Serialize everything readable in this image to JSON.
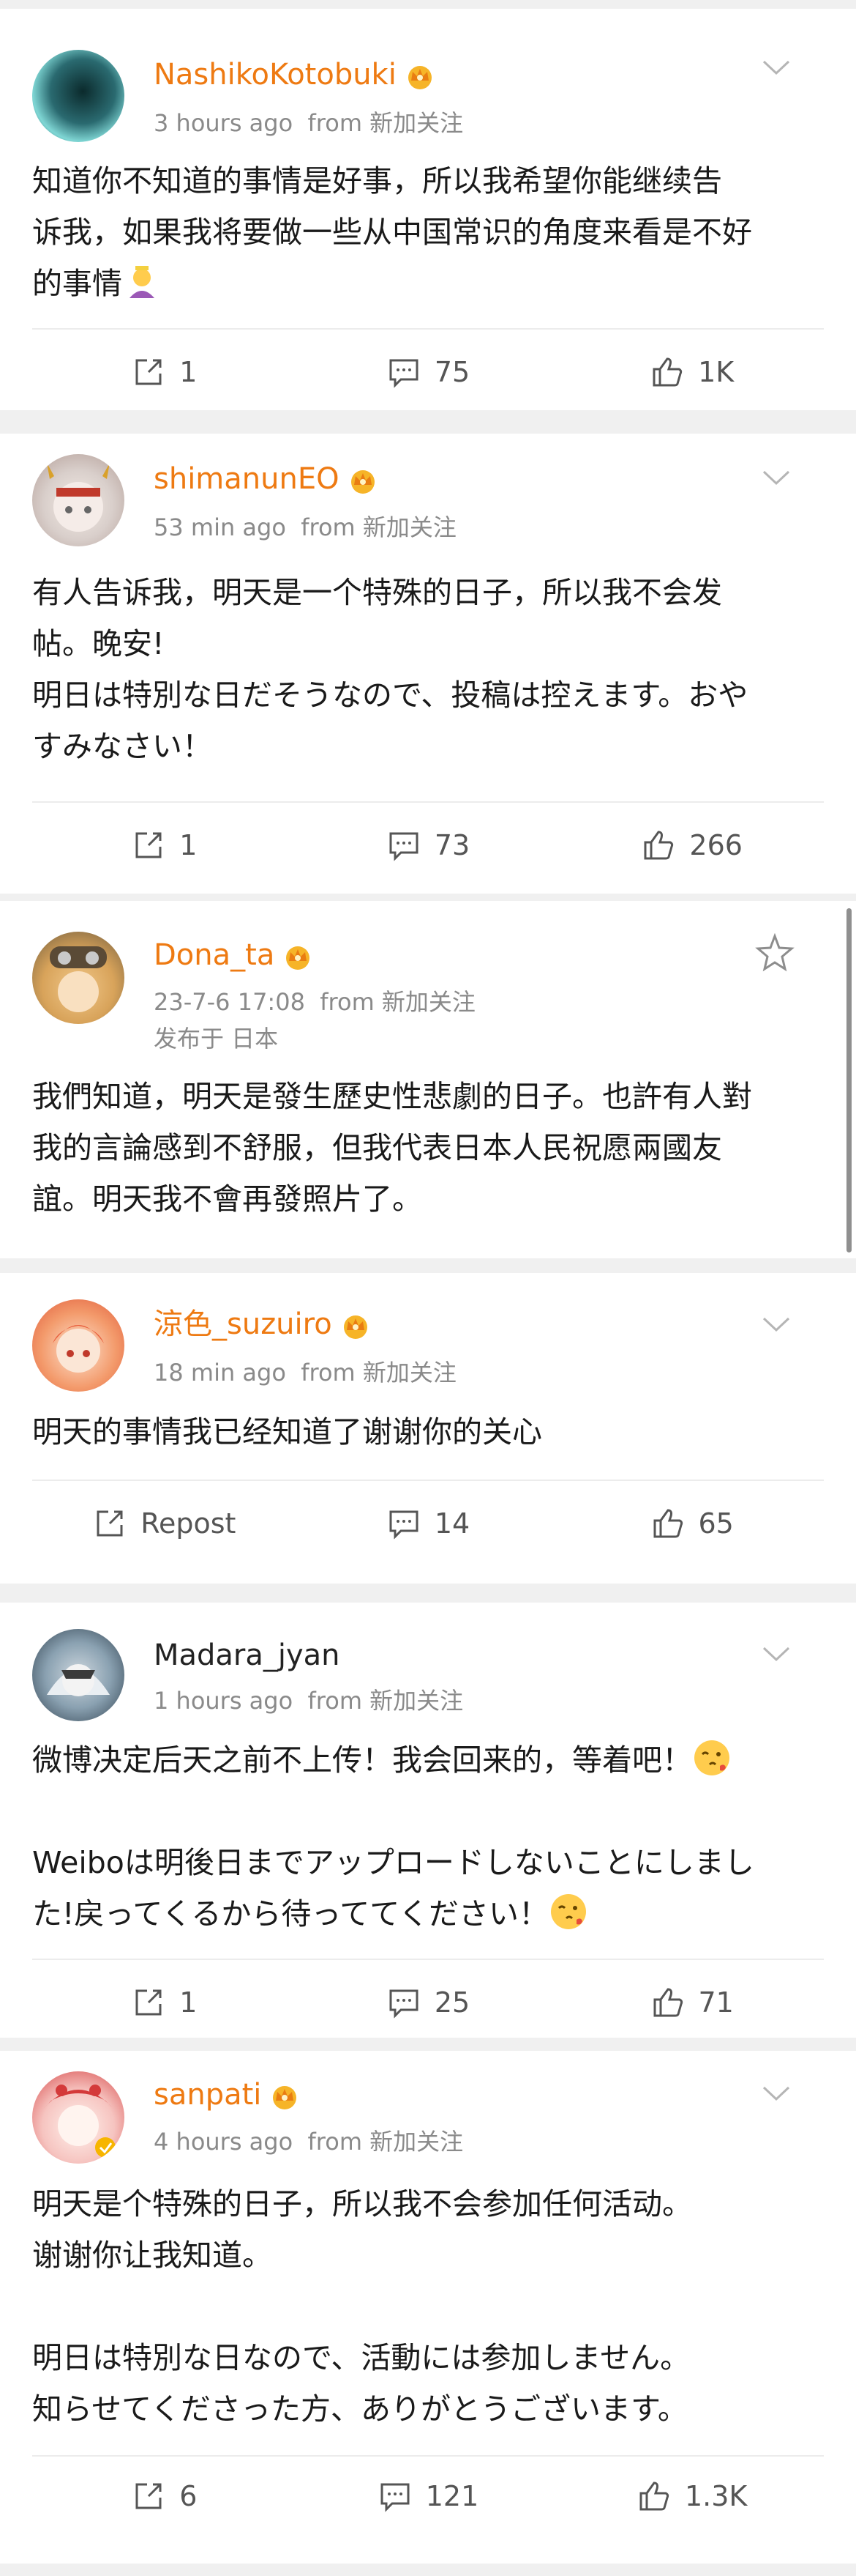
{
  "posts": [
    {
      "username": "NashikoKotobuki",
      "vip": true,
      "time": "3 hours ago",
      "source": "from 新加关注",
      "content": "知道你不知道的事情是好事，所以我希望你能继续告\n诉我，如果我将要做一些从中国常识的角度来看是不好\n的事情",
      "emoji": "person-bowing-emoji",
      "repost": "1",
      "comments": "75",
      "likes": "1K"
    },
    {
      "username": "shimanunEO",
      "vip": true,
      "time": "53 min ago",
      "source": "from 新加关注",
      "content": "有人告诉我，明天是一个特殊的日子，所以我不会发\n帖。晚安!\n明日は特別な日だそうなので、投稿は控えます。おや\nすみなさい！",
      "repost": "1",
      "comments": "73",
      "likes": "266"
    },
    {
      "username": "Dona_ta",
      "vip": true,
      "time": "23-7-6 17:08",
      "source": "from 新加关注",
      "location": "发布于 日本",
      "content": "我們知道，明天是發生歷史性悲劇的日子。也許有人對\n我的言論感到不舒服，但我代表日本人民祝愿兩國友\n誼。明天我不會再發照片了。"
    },
    {
      "username": "涼色_suzuiro",
      "vip": true,
      "time": "18 min ago",
      "source": "from 新加关注",
      "content": "明天的事情我已经知道了谢谢你的关心",
      "repost": "Repost",
      "comments": "14",
      "likes": "65"
    },
    {
      "username": "Madara_jyan",
      "vip": false,
      "time": "1 hours ago",
      "source": "from 新加关注",
      "content1": "微博决定后天之前不上传！我会回来的，等着吧！",
      "content2": "Weiboは明後日までアップロードしないことにしまし\nた!戻ってくるから待っててください！",
      "repost": "1",
      "comments": "25",
      "likes": "71"
    },
    {
      "username": "sanpati",
      "vip": true,
      "time": "4 hours ago",
      "source": "from 新加关注",
      "content": "明天是个特殊的日子，所以我不会参加任何活动。\n谢谢你让我知道。\n\n明日は特別な日なので、活動には参加しません。\n知らせてくださった方、ありがとうございます。",
      "repost": "6",
      "comments": "121",
      "likes": "1.3K"
    }
  ],
  "colors": {
    "vip_name": "#ee7a12",
    "meta": "#8a8a8a",
    "background": "#f0f0f0"
  }
}
